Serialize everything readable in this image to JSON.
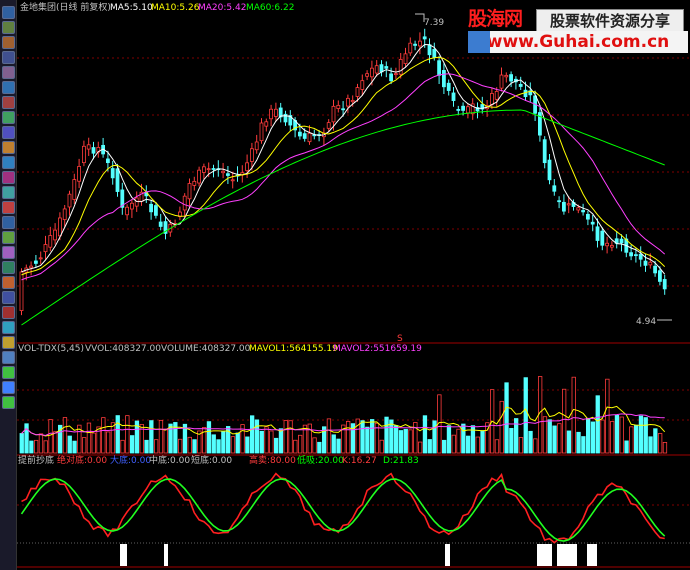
{
  "main_panel": {
    "stock_name": "金地集团(日线 前复权)",
    "ma5": "MA5:5.10",
    "ma10": "MA10:5.26",
    "ma20": "MA20:5.42",
    "ma60": "MA60:6.22",
    "high_label": "7.39",
    "low_label": "4.94",
    "divider_marker": "S"
  },
  "volume_panel": {
    "indicator": "VOL-TDX(5,45)",
    "vvol": "VVOL:408327.00",
    "volume": "VOLUME:408327.00",
    "mavol1": "MAVOL1:564155.19",
    "mavol2": "MAVOL2:551659.19"
  },
  "indicator_panel": {
    "name": "提前抄底",
    "absolute_bottom": "绝对底:0.00",
    "big_bottom": "大底:0.00",
    "mid_bottom": "中底:0.00",
    "short_bottom": "短底:0.00",
    "high_sell": "高卖:80.00",
    "low_suck": "低吸:20.00",
    "k": "K:16.27",
    "d": "D:21.83"
  },
  "watermark": {
    "title": "股海网",
    "subtitle": "股票软件资源分享",
    "url": "www.Guhai.com.cn"
  },
  "colors": {
    "up": "#ff3c3c",
    "down": "#54ffff",
    "ma5": "#ffffff",
    "ma10": "#ffff00",
    "ma20": "#ff40ff",
    "ma60": "#00ff00",
    "k_line": "#ff2020",
    "d_line": "#20ff20",
    "grid": "#800000"
  }
}
